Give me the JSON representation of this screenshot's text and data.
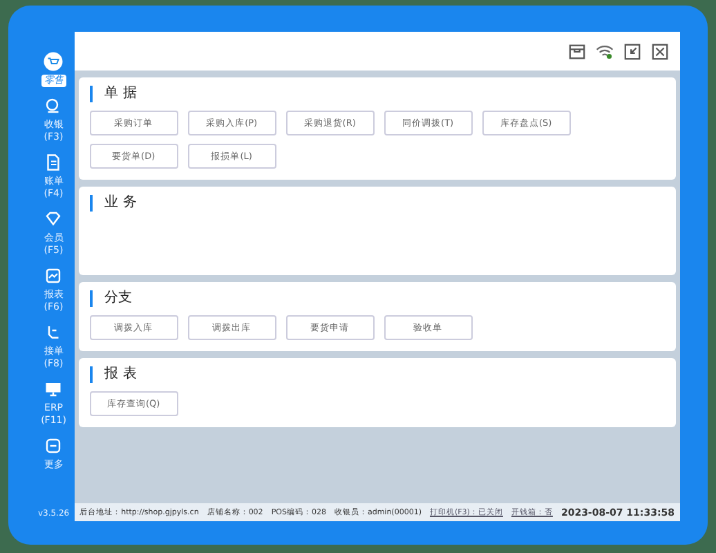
{
  "sidebar": {
    "items": [
      {
        "label": "零售",
        "selected": true
      },
      {
        "label": "收银\n(F3)",
        "selected": false
      },
      {
        "label": "账单\n(F4)",
        "selected": false
      },
      {
        "label": "会员\n(F5)",
        "selected": false
      },
      {
        "label": "报表\n(F6)",
        "selected": false
      },
      {
        "label": "接单\n(F8)",
        "selected": false
      },
      {
        "label": "ERP\n(F11)",
        "selected": false
      },
      {
        "label": "更多",
        "selected": false
      }
    ],
    "version": "v3.5.26"
  },
  "sections": [
    {
      "title": "单 据",
      "buttons": [
        "采购订单",
        "采购入库(P)",
        "采购退货(R)",
        "同价调拨(T)",
        "库存盘点(S)",
        "要货单(D)",
        "报损单(L)"
      ]
    },
    {
      "title": "业 务"
    },
    {
      "title": "分支",
      "buttons": [
        "调拨入库",
        "调拨出库",
        "要货申请",
        "验收单"
      ]
    },
    {
      "title": "报 表",
      "buttons": [
        "库存查询(Q)"
      ]
    }
  ],
  "status_bar": {
    "items": [
      "后台地址：http://shop.gjpyls.cn",
      "店铺名称：002",
      "POS编码：028",
      "收银员：admin(00001)",
      "打印机(F3)：已关闭",
      "开钱箱：否"
    ],
    "time": "2023-08-07 11:33:58"
  }
}
